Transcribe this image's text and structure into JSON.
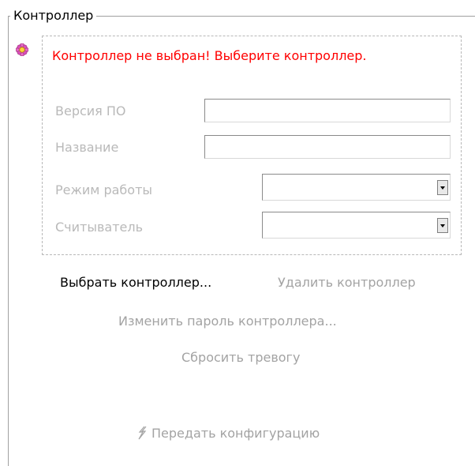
{
  "group": {
    "title": "Контроллер"
  },
  "status": {
    "icon": "gear-flower-icon",
    "error_text": "Контроллер не выбран! Выберите контроллер."
  },
  "fields": {
    "firmware": {
      "label": "Версия ПО",
      "value": ""
    },
    "name": {
      "label": "Название",
      "value": ""
    },
    "mode": {
      "label": "Режим работы",
      "value": ""
    },
    "reader": {
      "label": "Считыватель",
      "value": ""
    }
  },
  "actions": {
    "select_controller": "Выбрать контроллер...",
    "delete_controller": "Удалить контроллер",
    "change_password": "Изменить пароль контроллера...",
    "reset_alarm": "Сбросить тревогу",
    "transfer_config": "Передать конфигурацию"
  },
  "colors": {
    "error": "#ff0000",
    "disabled_text": "#a3a3a3",
    "label_text": "#b9b9b9"
  }
}
